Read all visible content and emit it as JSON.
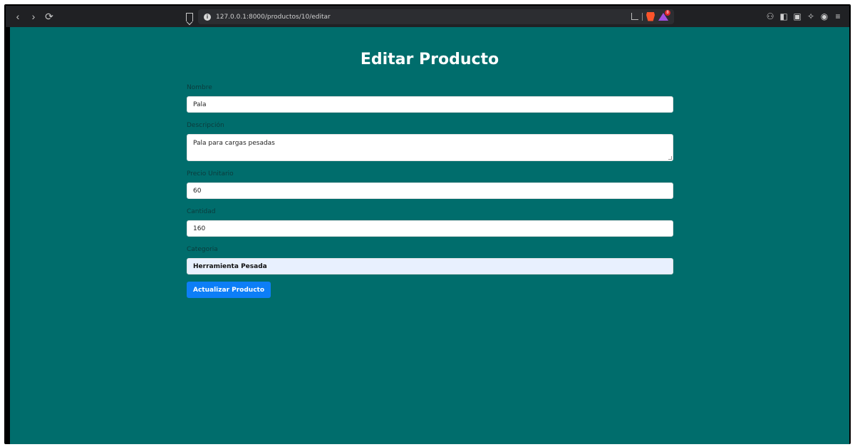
{
  "browser": {
    "url": "127.0.0.1:8000/productos/10/editar",
    "nav_icons": [
      "back-icon",
      "forward-icon",
      "reload-icon"
    ],
    "rewards_badge": "8",
    "right_icons": [
      "extensions-icon",
      "sidebar-icon",
      "wallet-icon",
      "leo-icon",
      "vpn-icon",
      "menu-icon"
    ]
  },
  "page": {
    "title": "Editar Producto",
    "background": "#006d6c",
    "form": {
      "nombre": {
        "label": "Nombre",
        "value": "Pala"
      },
      "descripcion": {
        "label": "Descripción",
        "value": "Pala para cargas pesadas"
      },
      "precio": {
        "label": "Precio Unitario",
        "value": "60"
      },
      "cantidad": {
        "label": "Cantidad",
        "value": "160"
      },
      "categoria": {
        "label": "Categoria",
        "value": "Herramienta Pesada"
      },
      "submit_label": "Actualizar Producto"
    }
  }
}
